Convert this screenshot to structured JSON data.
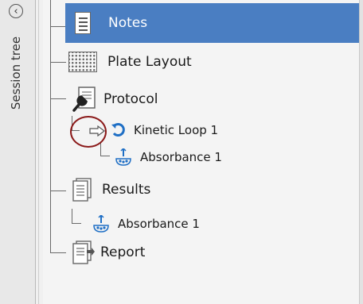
{
  "sidebar": {
    "title": "Session tree",
    "collapse_icon": "chevron-left-icon"
  },
  "tree": {
    "items": [
      {
        "label": "Notes",
        "icon": "notes-icon",
        "selected": true
      },
      {
        "label": "Plate Layout",
        "icon": "plate-layout-icon"
      },
      {
        "label": "Protocol",
        "icon": "wrench-document-icon"
      },
      {
        "label": "Kinetic Loop 1",
        "icon": "loop-icon"
      },
      {
        "label": "Absorbance 1",
        "icon": "absorbance-icon"
      },
      {
        "label": "Results",
        "icon": "document-icon"
      },
      {
        "label": "Absorbance 1",
        "icon": "absorbance-icon"
      },
      {
        "label": "Report",
        "icon": "report-icon"
      }
    ]
  },
  "colors": {
    "selection": "#4a7ec2",
    "highlight_circle": "#8b1a1a",
    "loop_blue": "#1f6fc5"
  }
}
